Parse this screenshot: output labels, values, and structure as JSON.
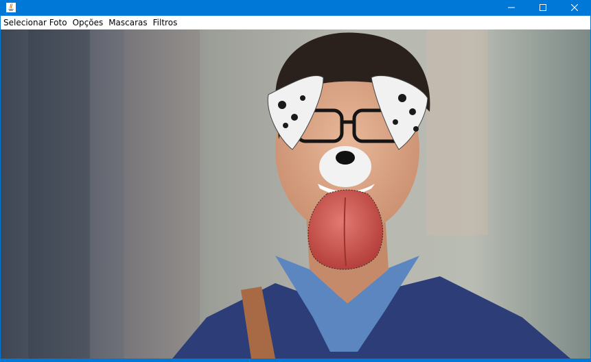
{
  "window": {
    "title": "",
    "controls": {
      "minimize_icon": "minimize-icon",
      "maximize_icon": "maximize-icon",
      "close_icon": "close-icon"
    },
    "accent_color": "#0078d7"
  },
  "menubar": {
    "items": [
      {
        "label": "Selecionar Foto"
      },
      {
        "label": "Opções"
      },
      {
        "label": "Mascaras"
      },
      {
        "label": "Filtros"
      }
    ]
  },
  "canvas": {
    "content": "photo-with-dog-mask-filter"
  }
}
